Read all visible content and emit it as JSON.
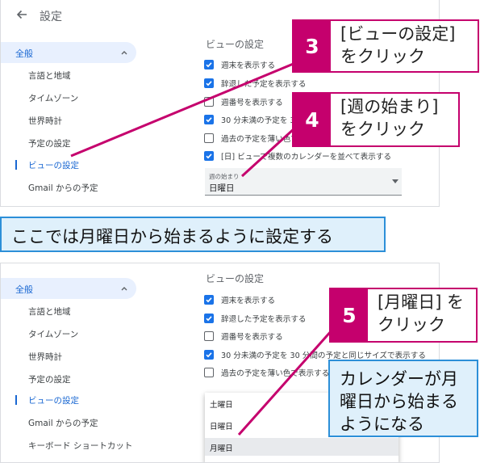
{
  "colors": {
    "accent": "#1a73e8",
    "callout": "#c5006d",
    "note_border": "#2c8fd8",
    "note_bg": "#dff0fb"
  },
  "screen1": {
    "header": {
      "back_icon": "arrow-left-icon",
      "title": "設定"
    },
    "sidebar": {
      "general": "全般",
      "items": [
        "言語と地域",
        "タイムゾーン",
        "世界時計",
        "予定の設定",
        "ビューの設定",
        "Gmail からの予定"
      ]
    },
    "section_title": "ビューの設定",
    "options": [
      {
        "label": "週末を表示する",
        "checked": true
      },
      {
        "label": "辞退した予定を表示する",
        "checked": true
      },
      {
        "label": "週番号を表示する",
        "checked": false
      },
      {
        "label": "30 分未満の予定を 30",
        "checked": true
      },
      {
        "label": "過去の予定を薄い色で",
        "checked": false
      },
      {
        "label": "[日] ビューで複数のカレンダーを並べて表示する",
        "checked": true
      }
    ],
    "week_start": {
      "caption": "週の始まり",
      "value": "日曜日"
    }
  },
  "screen2": {
    "sidebar": {
      "general": "全般",
      "items": [
        "言語と地域",
        "タイムゾーン",
        "世界時計",
        "予定の設定",
        "ビューの設定",
        "Gmail からの予定",
        "キーボード ショートカット"
      ]
    },
    "section_title": "ビューの設定",
    "options": [
      {
        "label": "週末を表示する",
        "checked": true
      },
      {
        "label": "辞退した予定を表示する",
        "checked": true
      },
      {
        "label": "週番号を表示する",
        "checked": false
      },
      {
        "label": "30 分未満の予定を 30 分間の予定と同じサイズで表示する",
        "checked": true
      },
      {
        "label": "過去の予定を薄い色で表示する",
        "checked": false
      }
    ],
    "dropdown_options": [
      "土曜日",
      "日曜日",
      "月曜日"
    ]
  },
  "callouts": [
    {
      "num": "3",
      "lines": [
        "[ビューの設定]",
        "をクリック"
      ]
    },
    {
      "num": "4",
      "lines": [
        "[週の始まり]",
        "をクリック"
      ]
    },
    {
      "num": "5",
      "lines": [
        "[月曜日] を",
        "クリック"
      ]
    }
  ],
  "banner": "ここでは月曜日から始まるように設定する",
  "note": [
    "カレンダーが月",
    "曜日から始まる",
    "ようになる"
  ]
}
